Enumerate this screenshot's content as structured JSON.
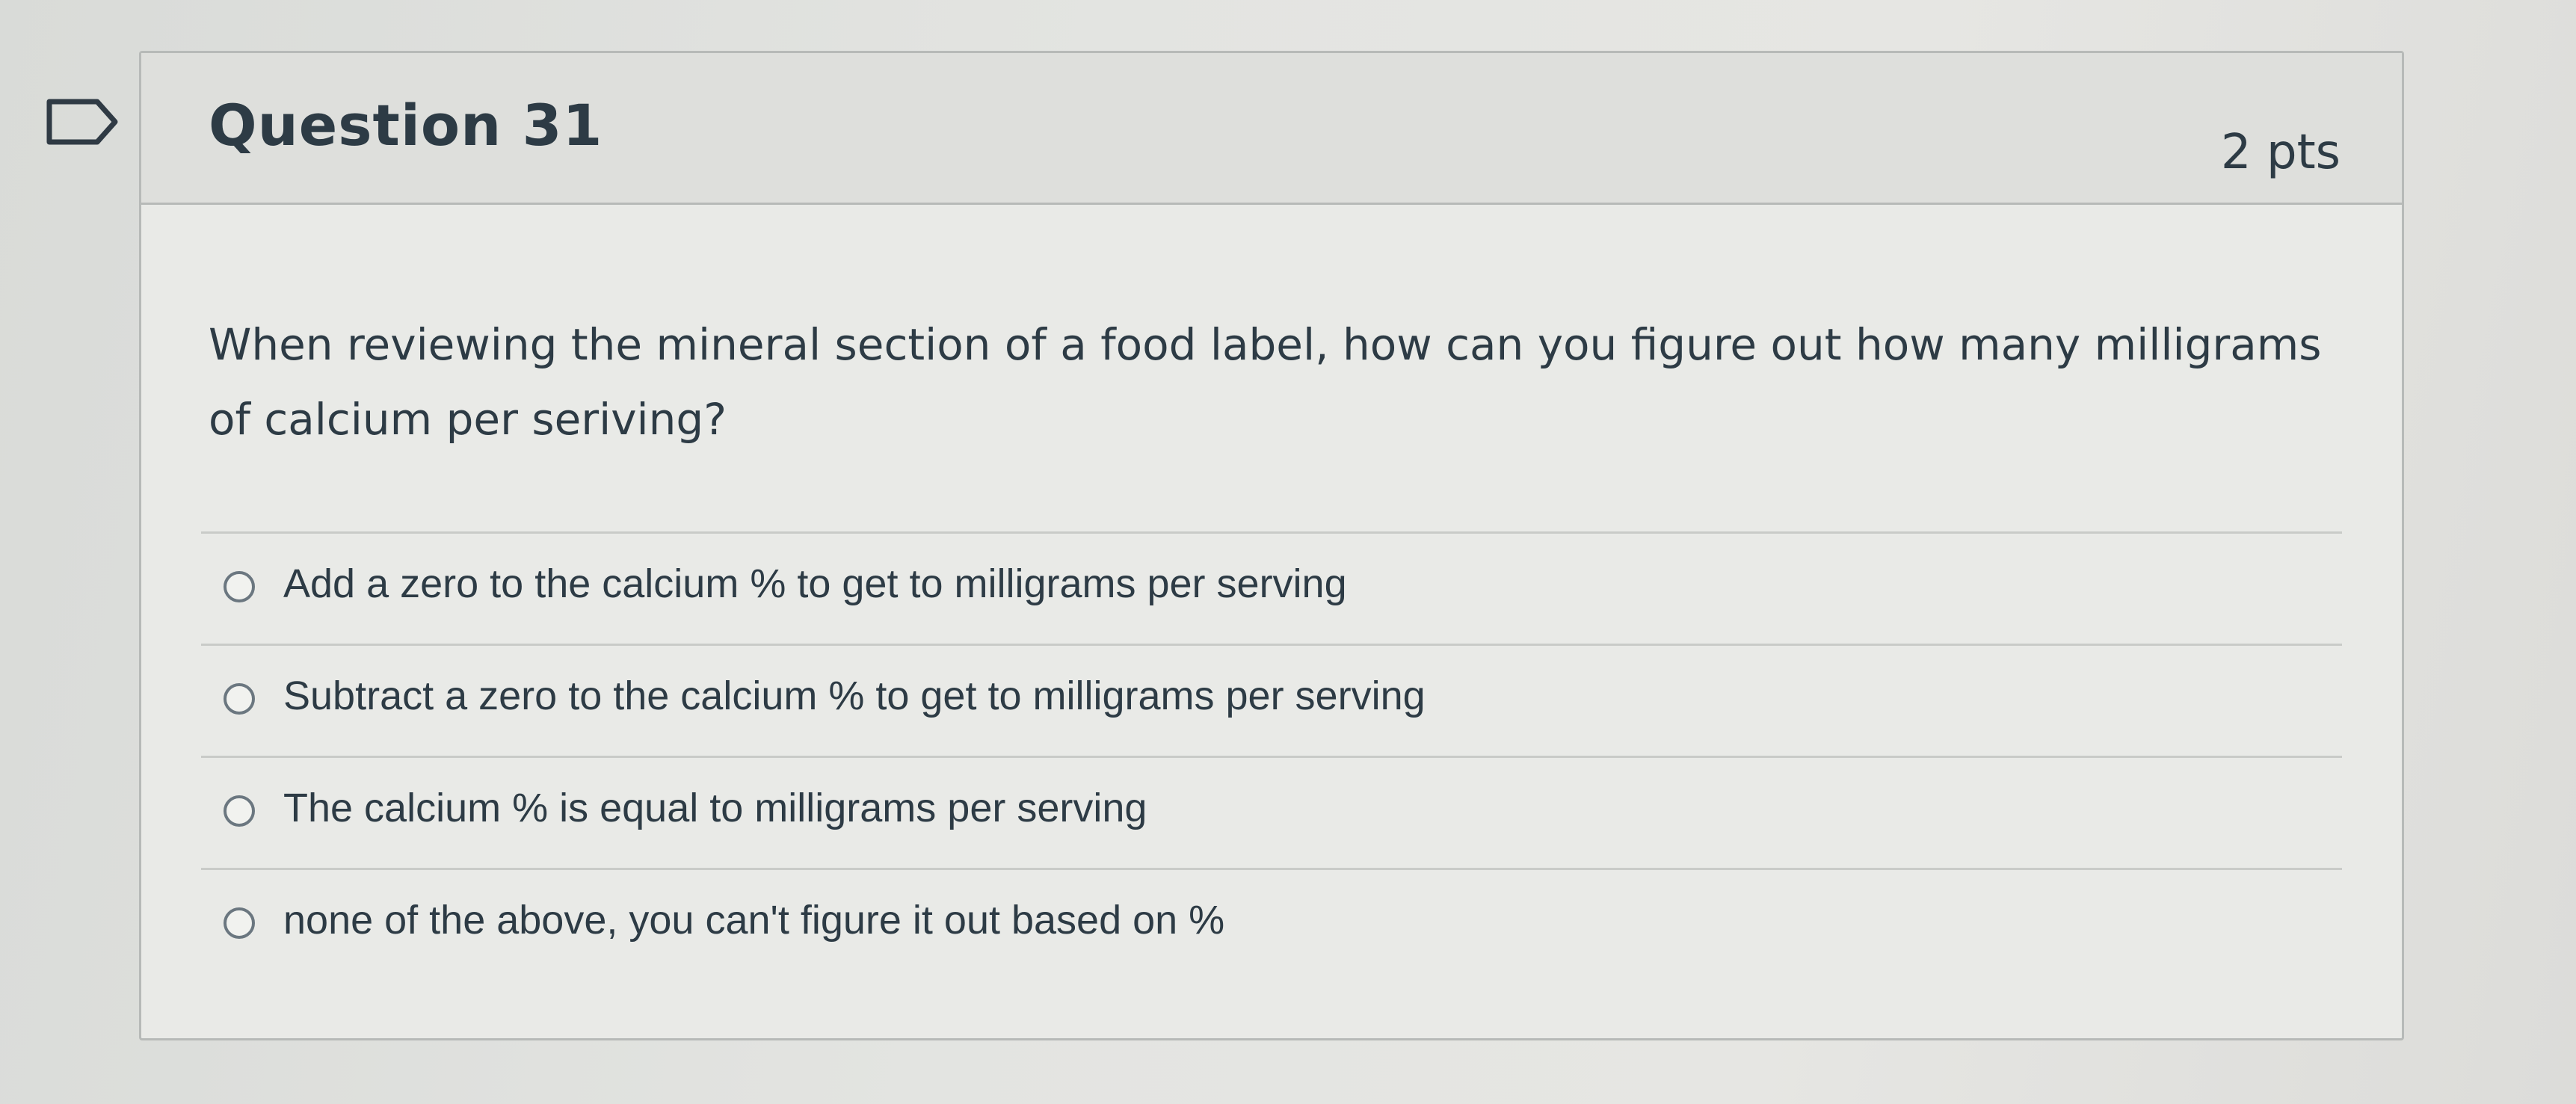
{
  "flag": {
    "icon": "bookmark-flag-icon"
  },
  "question": {
    "title": "Question 31",
    "points": "2 pts",
    "text": "When reviewing the mineral section of a food label, how can you figure out how many milligrams of calcium  per seriving?",
    "answers": [
      {
        "label": "Add a zero to the calcium % to get to milligrams per serving"
      },
      {
        "label": "Subtract a zero to the calcium % to get to milligrams per serving"
      },
      {
        "label": "The calcium % is equal to milligrams per serving"
      },
      {
        "label": "none of the above, you can't figure it out based on %"
      }
    ]
  }
}
